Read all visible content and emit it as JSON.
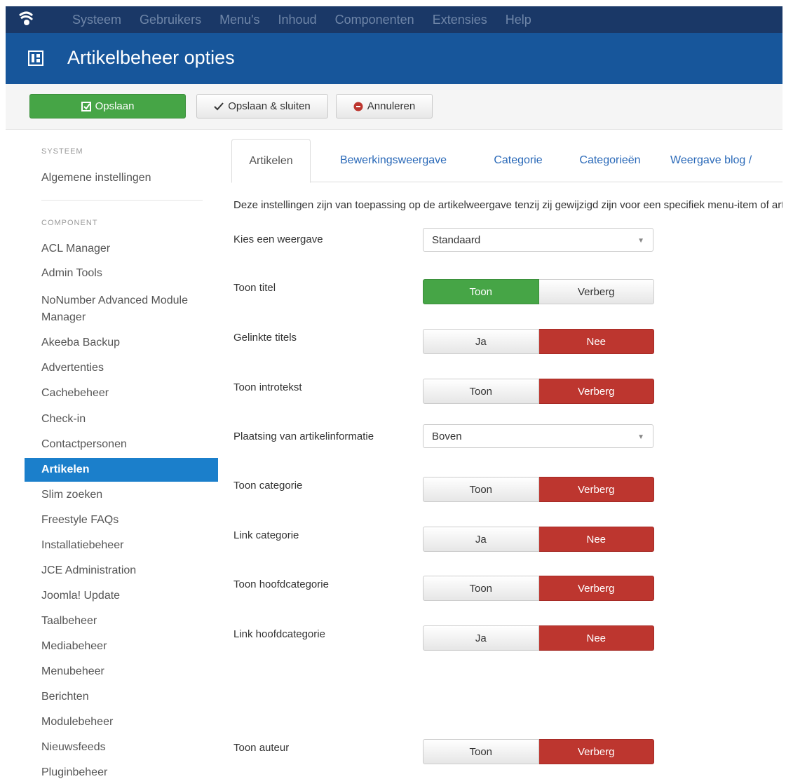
{
  "topnav": {
    "menu": [
      "Systeem",
      "Gebruikers",
      "Menu's",
      "Inhoud",
      "Componenten",
      "Extensies",
      "Help"
    ]
  },
  "header": {
    "title": "Artikelbeheer opties"
  },
  "toolbar": {
    "save_label": "Opslaan",
    "save_close_label": "Opslaan & sluiten",
    "cancel_label": "Annuleren"
  },
  "sidebar": {
    "system_heading": "SYSTEEM",
    "system_items": [
      "Algemene instellingen"
    ],
    "component_heading": "COMPONENT",
    "component_items": [
      "ACL Manager",
      "Admin Tools",
      "NoNumber Advanced Module Manager",
      "Akeeba Backup",
      "Advertenties",
      "Cachebeheer",
      "Check-in",
      "Contactpersonen",
      "Artikelen",
      "Slim zoeken",
      "Freestyle FAQs",
      "Installatiebeheer",
      "JCE Administration",
      "Joomla! Update",
      "Taalbeheer",
      "Mediabeheer",
      "Menubeheer",
      "Berichten",
      "Modulebeheer",
      "Nieuwsfeeds",
      "Pluginbeheer"
    ],
    "active_item": "Artikelen"
  },
  "tabs": [
    "Artikelen",
    "Bewerkingsweergave",
    "Categorie",
    "Categorieën",
    "Weergave blog /"
  ],
  "intro": "Deze instellingen zijn van toepassing op de artikelweergave tenzij zij gewijzigd zijn voor een specifiek menu-item of artikel.",
  "form": {
    "layout": {
      "label": "Kies een weergave",
      "value": "Standaard"
    },
    "show_title": {
      "label": "Toon titel",
      "options": [
        "Toon",
        "Verberg"
      ],
      "selected": "Toon"
    },
    "linked_titles": {
      "label": "Gelinkte titels",
      "options": [
        "Ja",
        "Nee"
      ],
      "selected": "Nee"
    },
    "show_intro": {
      "label": "Toon introtekst",
      "options": [
        "Toon",
        "Verberg"
      ],
      "selected": "Verberg"
    },
    "info_position": {
      "label": "Plaatsing van artikelinformatie",
      "value": "Boven"
    },
    "show_category": {
      "label": "Toon categorie",
      "options": [
        "Toon",
        "Verberg"
      ],
      "selected": "Verberg"
    },
    "link_category": {
      "label": "Link categorie",
      "options": [
        "Ja",
        "Nee"
      ],
      "selected": "Nee"
    },
    "show_parent": {
      "label": "Toon hoofdcategorie",
      "options": [
        "Toon",
        "Verberg"
      ],
      "selected": "Verberg"
    },
    "link_parent": {
      "label": "Link hoofdcategorie",
      "options": [
        "Ja",
        "Nee"
      ],
      "selected": "Nee"
    },
    "show_author": {
      "label": "Toon auteur",
      "options": [
        "Toon",
        "Verberg"
      ],
      "selected": "Verberg"
    }
  },
  "colors": {
    "navbar": "#1a3867",
    "header": "#17569b",
    "green": "#46a546",
    "red": "#bd362f",
    "active": "#1b7fcb"
  }
}
